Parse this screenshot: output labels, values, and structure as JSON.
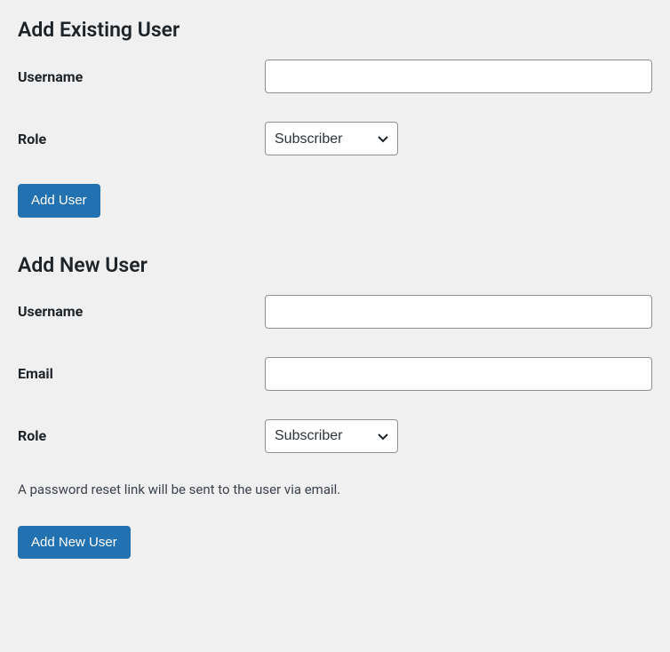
{
  "existing": {
    "heading": "Add Existing User",
    "username_label": "Username",
    "username_value": "",
    "role_label": "Role",
    "role_selected": "Subscriber",
    "submit_label": "Add User"
  },
  "new_user": {
    "heading": "Add New User",
    "username_label": "Username",
    "username_value": "",
    "email_label": "Email",
    "email_value": "",
    "role_label": "Role",
    "role_selected": "Subscriber",
    "description": "A password reset link will be sent to the user via email.",
    "submit_label": "Add New User"
  }
}
